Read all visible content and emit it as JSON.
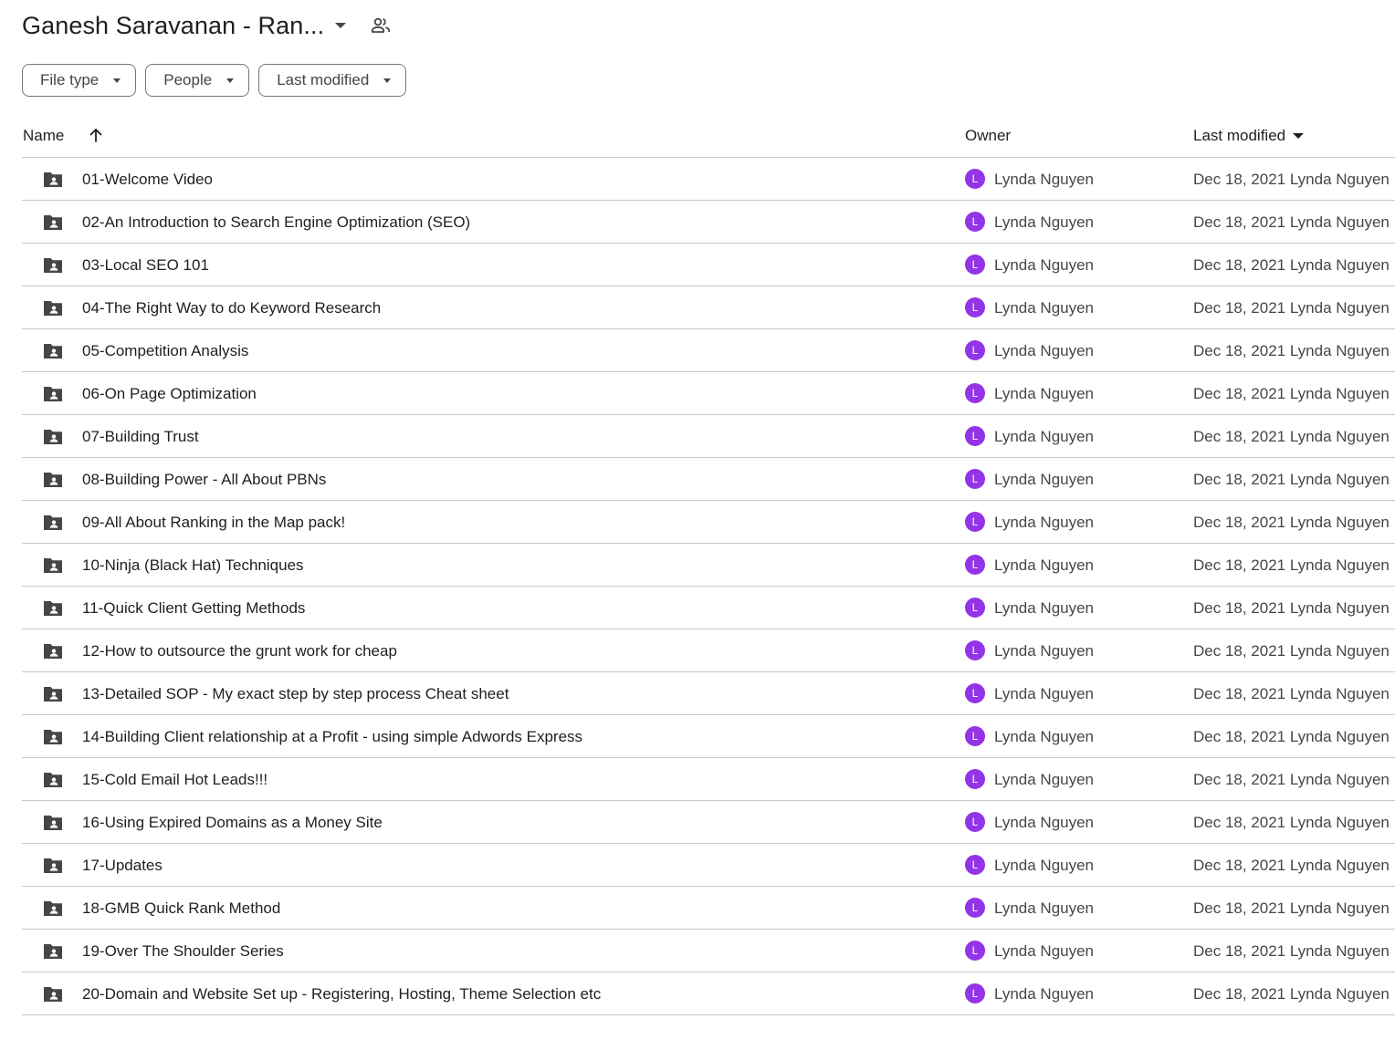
{
  "header": {
    "title": "Ganesh Saravanan - Ran..."
  },
  "filters": [
    {
      "label": "File type"
    },
    {
      "label": "People"
    },
    {
      "label": "Last modified"
    }
  ],
  "columns": {
    "name": "Name",
    "owner": "Owner",
    "last_modified": "Last modified"
  },
  "accent_color": "#9334e6",
  "icons": {
    "row_icon": "shared-folder-icon",
    "share_icon": "people-icon",
    "sort_icon": "arrow-up-icon"
  },
  "rows": [
    {
      "name": "01-Welcome Video",
      "owner_initial": "L",
      "owner": "Lynda Nguyen",
      "modified": "Dec 18, 2021 Lynda Nguyen"
    },
    {
      "name": "02-An Introduction to Search Engine Optimization (SEO)",
      "owner_initial": "L",
      "owner": "Lynda Nguyen",
      "modified": "Dec 18, 2021 Lynda Nguyen"
    },
    {
      "name": "03-Local SEO 101",
      "owner_initial": "L",
      "owner": "Lynda Nguyen",
      "modified": "Dec 18, 2021 Lynda Nguyen"
    },
    {
      "name": "04-The Right Way to do Keyword Research",
      "owner_initial": "L",
      "owner": "Lynda Nguyen",
      "modified": "Dec 18, 2021 Lynda Nguyen"
    },
    {
      "name": "05-Competition Analysis",
      "owner_initial": "L",
      "owner": "Lynda Nguyen",
      "modified": "Dec 18, 2021 Lynda Nguyen"
    },
    {
      "name": "06-On Page Optimization",
      "owner_initial": "L",
      "owner": "Lynda Nguyen",
      "modified": "Dec 18, 2021 Lynda Nguyen"
    },
    {
      "name": "07-Building Trust",
      "owner_initial": "L",
      "owner": "Lynda Nguyen",
      "modified": "Dec 18, 2021 Lynda Nguyen"
    },
    {
      "name": "08-Building Power - All About PBNs",
      "owner_initial": "L",
      "owner": "Lynda Nguyen",
      "modified": "Dec 18, 2021 Lynda Nguyen"
    },
    {
      "name": "09-All About Ranking in the Map pack!",
      "owner_initial": "L",
      "owner": "Lynda Nguyen",
      "modified": "Dec 18, 2021 Lynda Nguyen"
    },
    {
      "name": "10-Ninja (Black Hat) Techniques",
      "owner_initial": "L",
      "owner": "Lynda Nguyen",
      "modified": "Dec 18, 2021 Lynda Nguyen"
    },
    {
      "name": "11-Quick Client Getting Methods",
      "owner_initial": "L",
      "owner": "Lynda Nguyen",
      "modified": "Dec 18, 2021 Lynda Nguyen"
    },
    {
      "name": "12-How to outsource the grunt work for cheap",
      "owner_initial": "L",
      "owner": "Lynda Nguyen",
      "modified": "Dec 18, 2021 Lynda Nguyen"
    },
    {
      "name": "13-Detailed SOP - My exact step by step process Cheat sheet",
      "owner_initial": "L",
      "owner": "Lynda Nguyen",
      "modified": "Dec 18, 2021 Lynda Nguyen"
    },
    {
      "name": "14-Building Client relationship at a Profit - using simple Adwords Express",
      "owner_initial": "L",
      "owner": "Lynda Nguyen",
      "modified": "Dec 18, 2021 Lynda Nguyen"
    },
    {
      "name": "15-Cold Email Hot Leads!!!",
      "owner_initial": "L",
      "owner": "Lynda Nguyen",
      "modified": "Dec 18, 2021 Lynda Nguyen"
    },
    {
      "name": "16-Using Expired Domains as a Money Site",
      "owner_initial": "L",
      "owner": "Lynda Nguyen",
      "modified": "Dec 18, 2021 Lynda Nguyen"
    },
    {
      "name": "17-Updates",
      "owner_initial": "L",
      "owner": "Lynda Nguyen",
      "modified": "Dec 18, 2021 Lynda Nguyen"
    },
    {
      "name": "18-GMB Quick Rank Method",
      "owner_initial": "L",
      "owner": "Lynda Nguyen",
      "modified": "Dec 18, 2021 Lynda Nguyen"
    },
    {
      "name": "19-Over The Shoulder Series",
      "owner_initial": "L",
      "owner": "Lynda Nguyen",
      "modified": "Dec 18, 2021 Lynda Nguyen"
    },
    {
      "name": "20-Domain and Website Set up - Registering, Hosting, Theme Selection etc",
      "owner_initial": "L",
      "owner": "Lynda Nguyen",
      "modified": "Dec 18, 2021 Lynda Nguyen"
    }
  ]
}
